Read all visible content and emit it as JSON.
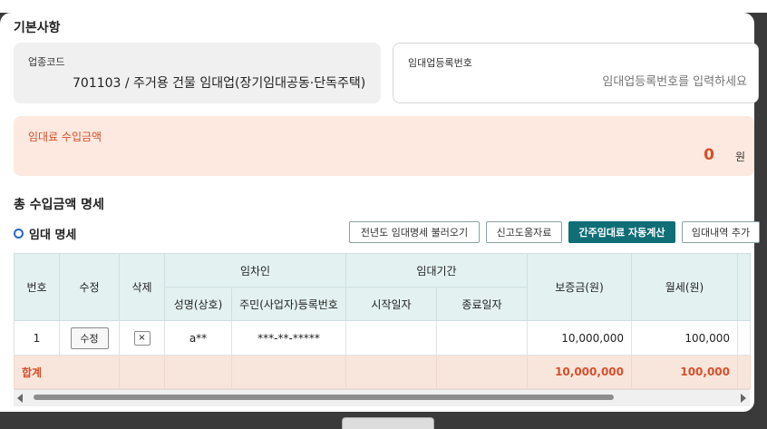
{
  "basic": {
    "section_title": "기본사항",
    "industry_code_label": "업종코드",
    "industry_code_value": "701103 / 주거용 건물 임대업(장기임대공동·단독주택)",
    "rental_reg_label": "임대업등록번호",
    "rental_reg_placeholder": "임대업등록번호를 입력하세요"
  },
  "income": {
    "label": "임대료 수입금액",
    "amount": "0",
    "unit": "원"
  },
  "details": {
    "section_title": "총 수입금액 명세",
    "sub_title": "임대 명세",
    "buttons": {
      "load_prev": "전년도 임대명세 불러오기",
      "report_help": "신고도움자료",
      "auto_calc": "간주임대료 자동계산",
      "add_rental": "임대내역 추가"
    }
  },
  "table": {
    "headers": {
      "no": "번호",
      "edit": "수정",
      "delete": "삭제",
      "lessee": "임차인",
      "name": "성명(상호)",
      "resident_no": "주민(사업자)등록번호",
      "period": "임대기간",
      "start": "시작일자",
      "end": "종료일자",
      "deposit": "보증금(원)",
      "monthly": "월세(원)"
    },
    "rows": [
      {
        "no": "1",
        "edit_label": "수정",
        "delete_label": "×",
        "name": "a**",
        "resident_no": "***-**-*****",
        "start": "",
        "end": "",
        "deposit": "10,000,000",
        "monthly": "100,000"
      }
    ],
    "total": {
      "label": "합계",
      "deposit": "10,000,000",
      "monthly": "100,000"
    }
  },
  "colors": {
    "accent": "#0f6e76",
    "income_bg": "#fde9df",
    "income_text": "#d4502b",
    "header_bg": "#e3f2f1"
  }
}
